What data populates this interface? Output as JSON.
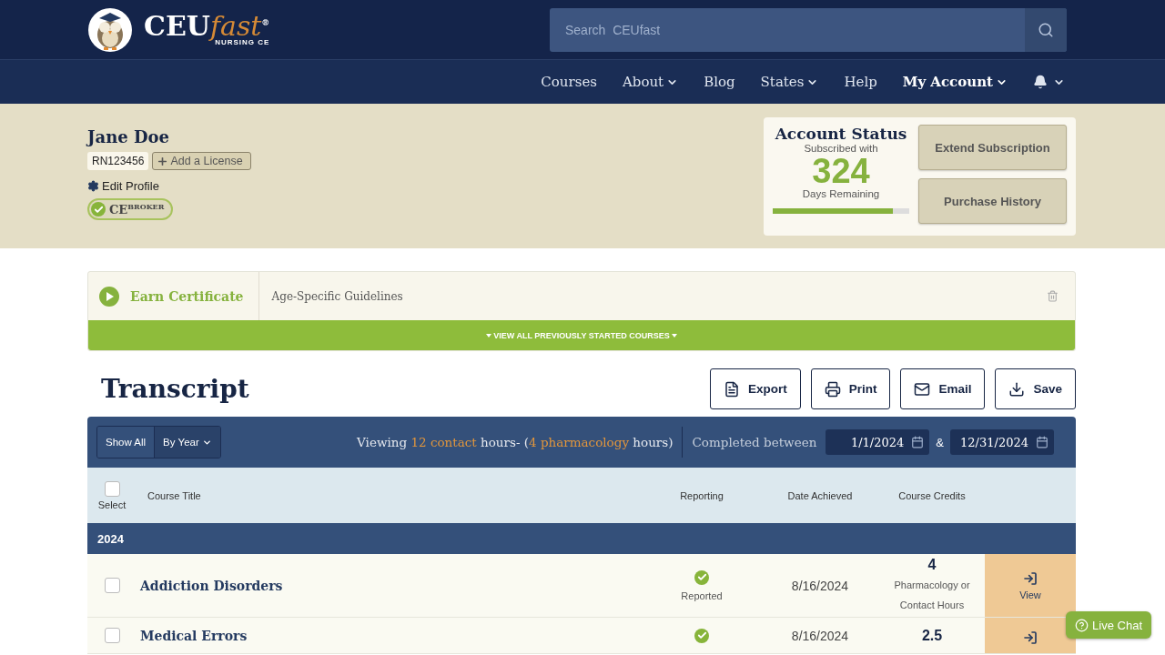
{
  "brand": {
    "name": "CEU",
    "accent": "fast",
    "registered": "®",
    "tagline": "NURSING CE"
  },
  "search": {
    "placeholder": "Search  CEUfast"
  },
  "nav": [
    {
      "label": "Courses",
      "dropdown": false,
      "bold": false
    },
    {
      "label": "About",
      "dropdown": true,
      "bold": false
    },
    {
      "label": "Blog",
      "dropdown": false,
      "bold": false
    },
    {
      "label": "States",
      "dropdown": true,
      "bold": false
    },
    {
      "label": "Help",
      "dropdown": false,
      "bold": false
    },
    {
      "label": "My Account",
      "dropdown": true,
      "bold": true
    }
  ],
  "profile": {
    "name": "Jane Doe",
    "license": "RN123456",
    "add_license": "Add a License",
    "edit_profile": "Edit Profile",
    "badge": {
      "main": "CE",
      "sup": "BROKER",
      "verified": true
    }
  },
  "account_status": {
    "title": "Account Status",
    "subscribed_label": "Subscribed with",
    "days": "324",
    "days_label": "Days Remaining",
    "level": 0.88,
    "buttons": [
      "Extend Subscription",
      "Purchase History"
    ]
  },
  "in_progress": {
    "action": "Earn Certificate",
    "course": "Age-Specific Guidelines",
    "view_all": "VIEW ALL PREVIOUSLY STARTED COURSES"
  },
  "transcript": {
    "title": "Transcript",
    "actions": [
      {
        "label": "Export",
        "kind": "file"
      },
      {
        "label": "Print",
        "kind": "print"
      },
      {
        "label": "Email",
        "kind": "mail"
      },
      {
        "label": "Save",
        "kind": "download"
      }
    ]
  },
  "filter": {
    "modes": [
      {
        "label": "Show All",
        "selected": false,
        "dropdown": false
      },
      {
        "label": "By Year",
        "selected": true,
        "dropdown": true
      }
    ],
    "summary": [
      {
        "text": "Viewing ",
        "highlight": false
      },
      {
        "text": "12 contact",
        "highlight": true
      },
      {
        "text": " hours- (",
        "highlight": false
      },
      {
        "text": "4 pharmacology",
        "highlight": true
      },
      {
        "text": " hours)",
        "highlight": false
      }
    ],
    "completed_label": "Completed between",
    "from": "1/1/2024",
    "joiner": "&",
    "to": "12/31/2024"
  },
  "columns": {
    "select": "Select",
    "select_all_checked": false,
    "title": "Course Title",
    "reporting": "Reporting",
    "date": "Date Achieved",
    "credits": "Course Credits"
  },
  "group": "2024",
  "rows": [
    {
      "title": "Addiction Disorders",
      "checked": false,
      "reported": true,
      "reporting": "Reported",
      "date": "8/16/2024",
      "credits": "4",
      "credits_note": "Pharmacology or Contact Hours",
      "action": "View"
    },
    {
      "title": "Medical Errors",
      "checked": false,
      "reported": true,
      "date": "8/16/2024",
      "credits": "2.5"
    }
  ],
  "live_chat": "Live Chat"
}
